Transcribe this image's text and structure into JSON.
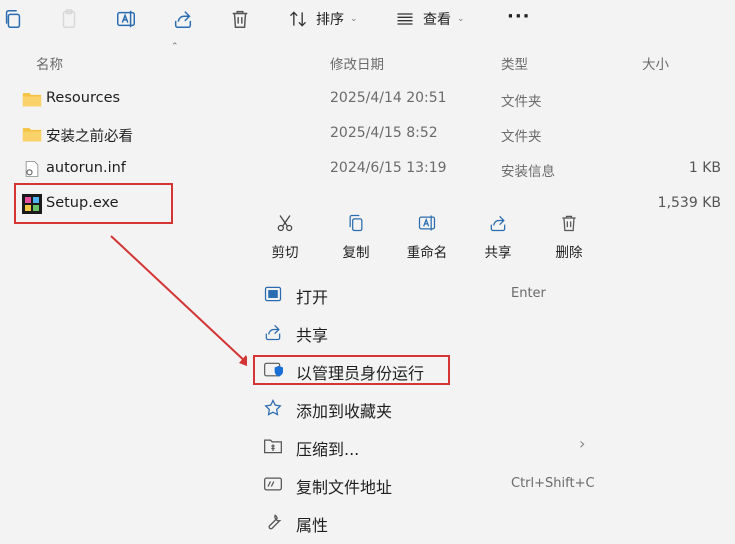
{
  "toolbar": {
    "sort_label": "排序",
    "view_label": "查看",
    "more_label": "···"
  },
  "columns": {
    "name": "名称",
    "modified": "修改日期",
    "type": "类型",
    "size": "大小"
  },
  "files": [
    {
      "name": "Resources",
      "date": "2025/4/14 20:51",
      "type": "文件夹",
      "size": "",
      "icon": "folder-icon"
    },
    {
      "name": "安装之前必看",
      "date": "2025/4/15 8:52",
      "type": "文件夹",
      "size": "",
      "icon": "folder-icon"
    },
    {
      "name": "autorun.inf",
      "date": "2024/6/15 13:19",
      "type": "安装信息",
      "size": "1 KB",
      "icon": "settings-file-icon"
    },
    {
      "name": "Setup.exe",
      "date": "",
      "type": "",
      "size": "1,539 KB",
      "icon": "setup-exe-icon"
    }
  ],
  "context_menu": {
    "quick_actions": [
      {
        "label": "剪切",
        "icon": "scissors-icon"
      },
      {
        "label": "复制",
        "icon": "copy-icon"
      },
      {
        "label": "重命名",
        "icon": "rename-icon"
      },
      {
        "label": "共享",
        "icon": "share-icon"
      },
      {
        "label": "删除",
        "icon": "trash-icon"
      }
    ],
    "items": [
      {
        "label": "打开",
        "shortcut": "Enter",
        "icon": "open-icon"
      },
      {
        "label": "共享",
        "shortcut": "",
        "icon": "share-icon"
      },
      {
        "label": "以管理员身份运行",
        "shortcut": "",
        "icon": "admin-shield-icon"
      },
      {
        "label": "添加到收藏夹",
        "shortcut": "",
        "icon": "star-icon"
      },
      {
        "label": "压缩到...",
        "shortcut": "",
        "icon": "compress-icon",
        "submenu_arrow": "›"
      },
      {
        "label": "复制文件地址",
        "shortcut": "Ctrl+Shift+C",
        "icon": "copy-path-icon"
      },
      {
        "label": "属性",
        "shortcut": "",
        "icon": "wrench-icon"
      }
    ]
  },
  "colors": {
    "annotation_red": "#d33434",
    "folder_yellow": "#f5c242",
    "shield_blue": "#1a6fd6"
  }
}
